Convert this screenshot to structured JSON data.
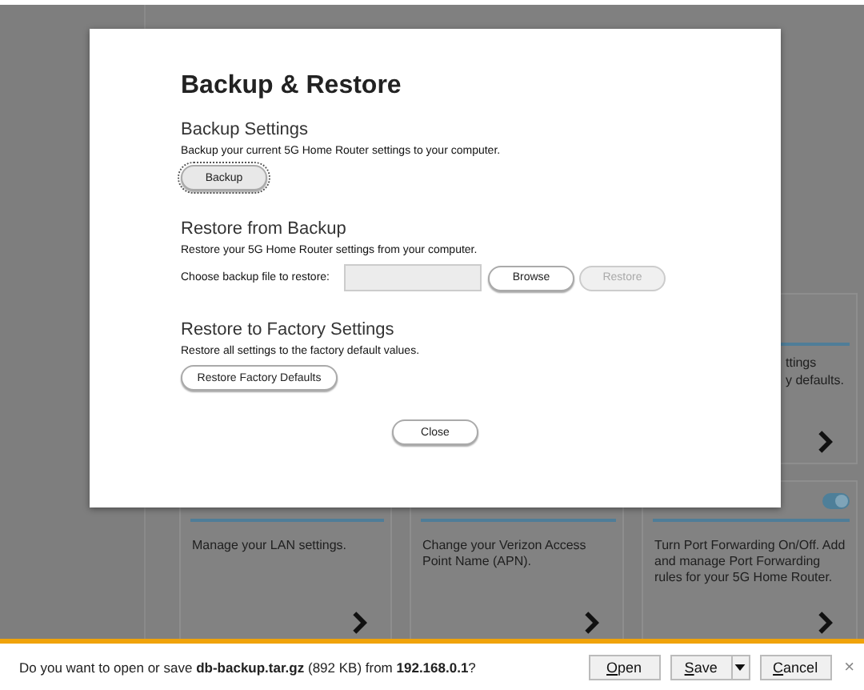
{
  "background": {
    "partial_card": {
      "lines": [
        "ttings",
        "y defaults."
      ]
    },
    "cards": [
      {
        "description": "Manage your LAN settings."
      },
      {
        "description": "Change your Verizon Access Point Name (APN)."
      },
      {
        "description": "Turn Port Forwarding On/Off. Add and manage Port Forwarding rules for your 5G Home Router.",
        "toggle": {
          "on": true
        }
      }
    ]
  },
  "dialog": {
    "title": "Backup & Restore",
    "sections": [
      {
        "kind": "button",
        "heading": "Backup Settings",
        "description": "Backup your current 5G Home Router settings to your computer.",
        "buttons": [
          {
            "label": "Backup",
            "focused": true,
            "disabled": false
          }
        ]
      },
      {
        "kind": "file",
        "heading": "Restore from Backup",
        "description": "Restore your 5G Home Router settings from your computer.",
        "field_label": "Choose backup file to restore:",
        "buttons": [
          {
            "label": "Browse",
            "focused": false,
            "disabled": false
          },
          {
            "label": "Restore",
            "focused": false,
            "disabled": true
          }
        ]
      },
      {
        "kind": "button",
        "heading": "Restore to Factory Settings",
        "description": "Restore all settings to the factory default values.",
        "buttons": [
          {
            "label": "Restore Factory Defaults",
            "focused": false,
            "disabled": false
          }
        ]
      }
    ],
    "close_button": "Close"
  },
  "download_bar": {
    "message": "Do you want to open or save **db-backup.tar.gz** (892 KB) from **192.168.0.1**?",
    "buttons": [
      {
        "label": "Open",
        "kind": "plain"
      },
      {
        "label": "Save",
        "kind": "split"
      },
      {
        "label": "Cancel",
        "kind": "plain"
      }
    ],
    "close": "×"
  }
}
